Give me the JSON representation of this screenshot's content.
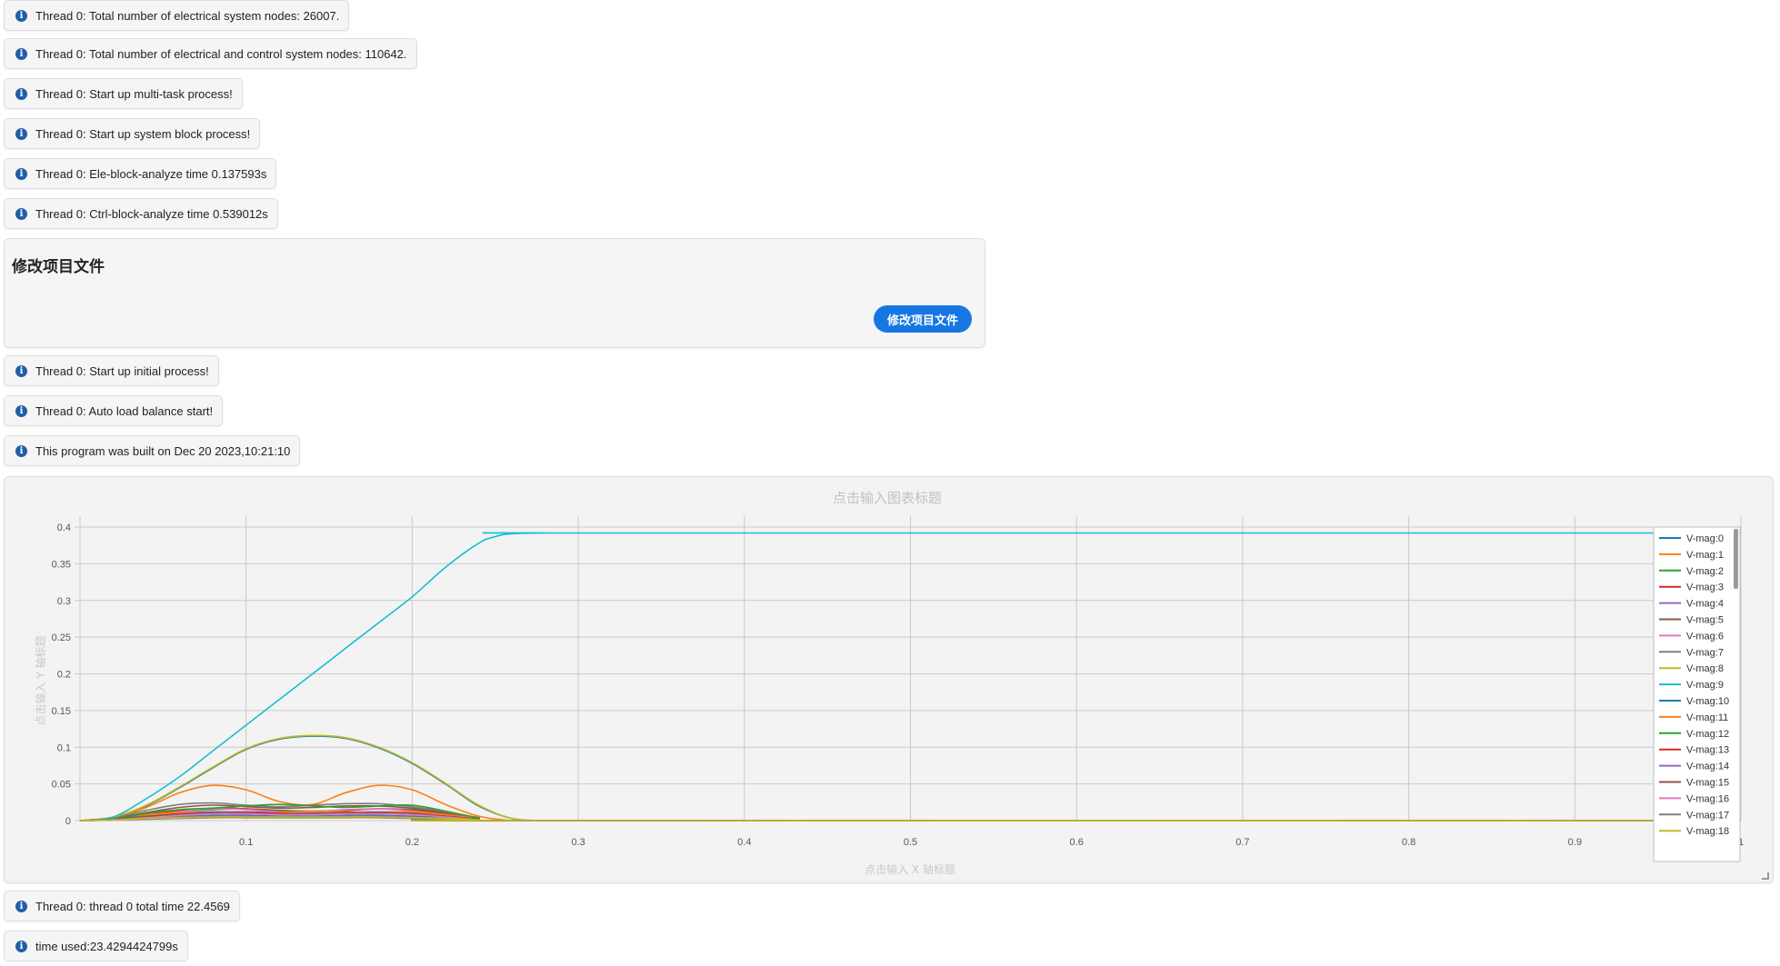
{
  "messages_top": [
    {
      "text": "Thread 0: Total number of electrical system nodes: 26007."
    },
    {
      "text": "Thread 0: Total number of electrical and control system nodes: 110642."
    },
    {
      "text": "Thread 0: Start up multi-task process!"
    },
    {
      "text": "Thread 0: Start up system block process!"
    },
    {
      "text": "Thread 0: Ele-block-analyze time 0.137593s"
    },
    {
      "text": "Thread 0: Ctrl-block-analyze time 0.539012s"
    }
  ],
  "edit_card": {
    "title": "修改项目文件",
    "button_label": "修改项目文件"
  },
  "messages_mid": [
    {
      "text": "Thread 0: Start up initial process!"
    },
    {
      "text": "Thread 0: Auto load balance start!"
    },
    {
      "text": "This program was built on Dec 20 2023,10:21:10"
    }
  ],
  "messages_bottom": [
    {
      "text": "Thread 0: thread 0 total time 22.4569"
    },
    {
      "text": "time used:23.4294424799s"
    }
  ],
  "icons": {
    "message_icon": "info-circle-icon",
    "resize_icon": "resize-grip-icon"
  },
  "chart_data": {
    "type": "line",
    "title": "点击输入图表标题",
    "xlabel": "点击输入 X 轴标题",
    "ylabel": "点击输入 Y 轴标题",
    "xlim": [
      0.0,
      1.0
    ],
    "ylim": [
      0,
      0.4
    ],
    "x_ticks": [
      "0.1",
      "0.2",
      "0.3",
      "0.4",
      "0.5",
      "0.6",
      "0.7",
      "0.8",
      "0.9",
      "1"
    ],
    "y_ticks": [
      "0",
      "0.05",
      "0.1",
      "0.15",
      "0.2",
      "0.25",
      "0.3",
      "0.35",
      "0.4"
    ],
    "x_tick_values": [
      0.1,
      0.2,
      0.3,
      0.4,
      0.5,
      0.6,
      0.7,
      0.8,
      0.9,
      1.0
    ],
    "y_tick_values": [
      0,
      0.05,
      0.1,
      0.15,
      0.2,
      0.25,
      0.3,
      0.35,
      0.4
    ],
    "grid": true,
    "legend_position": "right",
    "series": [
      {
        "name": "V-mag:0",
        "color": "#1f77b4",
        "x": [
          0,
          0.02,
          0.04,
          0.06,
          0.08,
          0.1,
          0.12,
          0.14,
          0.16,
          0.18,
          0.2,
          0.22,
          0.24,
          0.26,
          0.28,
          0.3,
          1.0
        ],
        "y": [
          0,
          0.004,
          0.02,
          0.045,
          0.072,
          0.097,
          0.111,
          0.115,
          0.112,
          0.099,
          0.078,
          0.05,
          0.02,
          0.003,
          0,
          0,
          0
        ]
      },
      {
        "name": "V-mag:1",
        "color": "#ff7f0e",
        "x": [
          0,
          0.02,
          0.04,
          0.06,
          0.08,
          0.1,
          0.12,
          0.14,
          0.16,
          0.18,
          0.2,
          0.22,
          0.24,
          0.26,
          0.28,
          1.0
        ],
        "y": [
          0,
          0.004,
          0.018,
          0.038,
          0.048,
          0.042,
          0.026,
          0.022,
          0.038,
          0.048,
          0.042,
          0.022,
          0.006,
          0,
          0,
          0
        ]
      },
      {
        "name": "V-mag:2",
        "color": "#2ca02c",
        "x": [
          0,
          0.02,
          0.04,
          0.06,
          0.08,
          0.1,
          0.12,
          0.14,
          0.16,
          0.18,
          0.2,
          0.22,
          0.24,
          0.26,
          1.0
        ],
        "y": [
          0,
          0.002,
          0.008,
          0.012,
          0.015,
          0.016,
          0.014,
          0.013,
          0.014,
          0.016,
          0.015,
          0.01,
          0.004,
          0,
          0
        ]
      },
      {
        "name": "V-mag:3",
        "color": "#d62728",
        "x": [
          0,
          0.02,
          0.04,
          0.06,
          0.08,
          0.1,
          0.12,
          0.14,
          0.16,
          0.18,
          0.2,
          0.22,
          0.24,
          0.26,
          1.0
        ],
        "y": [
          0,
          0.003,
          0.009,
          0.013,
          0.017,
          0.016,
          0.013,
          0.012,
          0.014,
          0.016,
          0.014,
          0.009,
          0.003,
          0,
          0
        ]
      },
      {
        "name": "V-mag:4",
        "color": "#9467bd",
        "x": [
          0,
          0.02,
          0.04,
          0.06,
          0.08,
          0.1,
          0.12,
          0.14,
          0.16,
          0.18,
          0.2,
          0.22,
          0.24,
          0.26,
          1.0
        ],
        "y": [
          0,
          0.002,
          0.006,
          0.01,
          0.012,
          0.012,
          0.011,
          0.01,
          0.011,
          0.012,
          0.011,
          0.007,
          0.002,
          0,
          0
        ]
      },
      {
        "name": "V-mag:5",
        "color": "#8c564b",
        "x": [
          0,
          0.02,
          0.04,
          0.06,
          0.08,
          0.1,
          0.12,
          0.14,
          0.16,
          0.18,
          0.2,
          0.22,
          0.24,
          0.26,
          1.0
        ],
        "y": [
          0,
          0.003,
          0.011,
          0.018,
          0.021,
          0.019,
          0.017,
          0.018,
          0.02,
          0.02,
          0.017,
          0.011,
          0.004,
          0,
          0
        ]
      },
      {
        "name": "V-mag:6",
        "color": "#e377c2",
        "x": [
          0,
          0.02,
          0.04,
          0.06,
          0.08,
          0.1,
          0.12,
          0.14,
          0.16,
          0.18,
          0.2,
          0.22,
          0.24,
          0.26,
          1.0
        ],
        "y": [
          0,
          0.002,
          0.007,
          0.012,
          0.016,
          0.015,
          0.012,
          0.012,
          0.015,
          0.016,
          0.013,
          0.008,
          0.002,
          0,
          0
        ]
      },
      {
        "name": "V-mag:7",
        "color": "#7f7f7f",
        "x": [
          0,
          0.02,
          0.04,
          0.06,
          0.08,
          0.1,
          0.12,
          0.14,
          0.16,
          0.18,
          0.2,
          0.22,
          0.24,
          0.26,
          1.0
        ],
        "y": [
          0,
          0.004,
          0.014,
          0.022,
          0.024,
          0.021,
          0.019,
          0.021,
          0.023,
          0.023,
          0.019,
          0.012,
          0.004,
          0,
          0
        ]
      },
      {
        "name": "V-mag:8",
        "color": "#bcbd22",
        "x": [
          0,
          0.02,
          0.04,
          0.06,
          0.08,
          0.1,
          0.12,
          0.14,
          0.16,
          0.18,
          0.2,
          0.22,
          0.24,
          0.26,
          0.28,
          0.3,
          1.0
        ],
        "y": [
          0,
          0.005,
          0.021,
          0.046,
          0.073,
          0.098,
          0.112,
          0.116,
          0.113,
          0.1,
          0.079,
          0.051,
          0.021,
          0.003,
          0,
          0,
          0
        ]
      },
      {
        "name": "V-mag:9",
        "color": "#17becf",
        "x": [
          0,
          0.02,
          0.04,
          0.06,
          0.08,
          0.1,
          0.12,
          0.14,
          0.16,
          0.18,
          0.2,
          0.22,
          0.24,
          0.25,
          0.26,
          0.28,
          0.3,
          1.0
        ],
        "y": [
          0,
          0.005,
          0.03,
          0.06,
          0.095,
          0.13,
          0.165,
          0.2,
          0.235,
          0.27,
          0.305,
          0.345,
          0.378,
          0.387,
          0.391,
          0.392,
          0.392,
          0.392
        ]
      },
      {
        "name": "V-mag:10",
        "color": "#1f77b4",
        "x": [
          0,
          0.02,
          0.04,
          0.06,
          0.08,
          0.1,
          0.12,
          0.14,
          0.16,
          0.18,
          0.2,
          0.22,
          0.24,
          0.26,
          1.0
        ],
        "y": [
          0,
          0.001,
          0.004,
          0.006,
          0.007,
          0.007,
          0.006,
          0.006,
          0.007,
          0.007,
          0.006,
          0.004,
          0.001,
          0,
          0
        ]
      },
      {
        "name": "V-mag:11",
        "color": "#ff7f0e",
        "x": [
          0,
          0.02,
          0.04,
          0.06,
          0.08,
          0.1,
          0.12,
          0.14,
          0.16,
          0.18,
          0.2,
          0.22,
          0.24,
          0.26,
          1.0
        ],
        "y": [
          0,
          0.002,
          0.008,
          0.011,
          0.01,
          0.009,
          0.011,
          0.013,
          0.012,
          0.011,
          0.012,
          0.008,
          0.003,
          0,
          0
        ]
      },
      {
        "name": "V-mag:12",
        "color": "#2ca02c",
        "x": [
          0,
          0.02,
          0.04,
          0.06,
          0.08,
          0.1,
          0.12,
          0.14,
          0.16,
          0.18,
          0.2,
          0.22,
          0.24,
          0.26,
          1.0
        ],
        "y": [
          0,
          0.002,
          0.01,
          0.015,
          0.017,
          0.02,
          0.022,
          0.02,
          0.018,
          0.02,
          0.021,
          0.013,
          0.004,
          0,
          0
        ]
      },
      {
        "name": "V-mag:13",
        "color": "#d62728",
        "x": [
          0,
          0.02,
          0.04,
          0.06,
          0.08,
          0.1,
          0.12,
          0.14,
          0.16,
          0.18,
          0.2,
          0.22,
          0.24,
          0.26,
          1.0
        ],
        "y": [
          0,
          0.001,
          0.005,
          0.008,
          0.01,
          0.011,
          0.01,
          0.009,
          0.01,
          0.011,
          0.009,
          0.006,
          0.002,
          0,
          0
        ]
      },
      {
        "name": "V-mag:14",
        "color": "#9467bd",
        "x": [
          0,
          0.02,
          0.04,
          0.06,
          0.08,
          0.1,
          0.12,
          0.14,
          0.16,
          0.18,
          0.2,
          0.22,
          0.24,
          0.26,
          1.0
        ],
        "y": [
          0,
          0.001,
          0.003,
          0.005,
          0.006,
          0.006,
          0.005,
          0.005,
          0.006,
          0.006,
          0.005,
          0.003,
          0.001,
          0,
          0
        ]
      },
      {
        "name": "V-mag:15",
        "color": "#8c564b",
        "x": [
          0,
          0.02,
          0.04,
          0.06,
          0.08,
          0.1,
          0.12,
          0.14,
          0.16,
          0.18,
          0.2,
          0.22,
          0.24,
          0.26,
          1.0
        ],
        "y": [
          0,
          0.002,
          0.006,
          0.009,
          0.011,
          0.01,
          0.009,
          0.01,
          0.011,
          0.011,
          0.01,
          0.006,
          0.002,
          0,
          0
        ]
      },
      {
        "name": "V-mag:16",
        "color": "#e377c2",
        "x": [
          0,
          0.02,
          0.04,
          0.06,
          0.08,
          0.1,
          0.12,
          0.14,
          0.16,
          0.18,
          0.2,
          0.22,
          0.24,
          0.26,
          1.0
        ],
        "y": [
          0,
          0.001,
          0.004,
          0.007,
          0.009,
          0.009,
          0.008,
          0.008,
          0.009,
          0.009,
          0.008,
          0.005,
          0.001,
          0,
          0
        ]
      },
      {
        "name": "V-mag:17",
        "color": "#7f7f7f",
        "x": [
          0,
          0.02,
          0.04,
          0.06,
          0.08,
          0.1,
          0.12,
          0.14,
          0.16,
          0.18,
          0.2,
          0.22,
          0.24,
          0.26,
          1.0
        ],
        "y": [
          0,
          0.001,
          0.002,
          0.003,
          0.004,
          0.004,
          0.004,
          0.004,
          0.004,
          0.004,
          0.003,
          0.002,
          0.001,
          0,
          0
        ]
      },
      {
        "name": "V-mag:18",
        "color": "#bcbd22",
        "x": [
          0,
          0.02,
          0.04,
          0.06,
          0.08,
          0.1,
          0.12,
          0.14,
          0.16,
          0.18,
          0.2,
          0.22,
          0.24,
          0.26,
          1.0
        ],
        "y": [
          0,
          0.001,
          0.003,
          0.004,
          0.005,
          0.005,
          0.005,
          0.005,
          0.005,
          0.005,
          0.004,
          0.003,
          0.001,
          0,
          0
        ]
      }
    ]
  }
}
